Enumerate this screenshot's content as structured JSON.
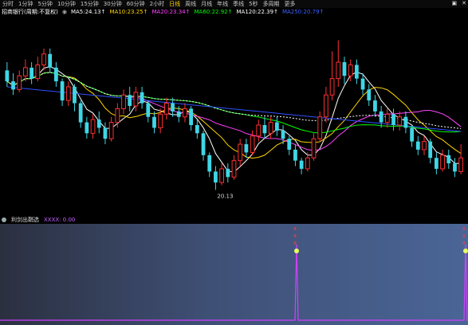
{
  "toolbar": {
    "periods": [
      "分时",
      "1分钟",
      "5分钟",
      "10分钟",
      "15分钟",
      "30分钟",
      "60分钟",
      "2小时",
      "日线",
      "周线",
      "月线",
      "年线",
      "季线",
      "5秒",
      "多周期",
      "更多"
    ],
    "active_period": "日线",
    "right_icons": [
      "grid-icon",
      "close-icon"
    ]
  },
  "ma_row": {
    "title": "招商银行(周期:不复权)",
    "items": [
      {
        "label": "MA5:",
        "value": "24.13",
        "arrow": "↑",
        "color": "#ffffff"
      },
      {
        "label": "MA10:",
        "value": "23.25",
        "arrow": "↑",
        "color": "#ffd400"
      },
      {
        "label": "MA20:",
        "value": "23.34",
        "arrow": "↑",
        "color": "#ff44ff"
      },
      {
        "label": "MA60:",
        "value": "22.92",
        "arrow": "↑",
        "color": "#00ff00"
      },
      {
        "label": "MA120:",
        "value": "22.39",
        "arrow": "↑",
        "color": "#ffffff"
      },
      {
        "label": "MA250:",
        "value": "20.79",
        "arrow": "↑",
        "color": "#4060ff"
      }
    ]
  },
  "chart_data": {
    "type": "candlestick",
    "low_label": "20.13",
    "colors": {
      "up": "#ff3030",
      "down": "#3fd6e6",
      "ma5": "#ffffff",
      "ma10": "#ffd400",
      "ma20": "#ff44ff",
      "ma60": "#00ff00",
      "ma120": "#ffffff",
      "ma250": "#3050ff"
    },
    "candles": [
      [
        24.5,
        24.1,
        24.8,
        23.9
      ],
      [
        24.1,
        23.8,
        24.4,
        23.6
      ],
      [
        23.8,
        24.3,
        24.5,
        23.7
      ],
      [
        24.3,
        24.6,
        24.9,
        24.1
      ],
      [
        24.6,
        24.2,
        24.8,
        24.0
      ],
      [
        24.2,
        24.7,
        25.0,
        24.1
      ],
      [
        24.7,
        25.1,
        25.3,
        24.5
      ],
      [
        25.1,
        24.6,
        25.3,
        24.4
      ],
      [
        24.6,
        24.1,
        24.8,
        23.9
      ],
      [
        24.1,
        23.4,
        24.2,
        23.2
      ],
      [
        23.4,
        23.9,
        24.1,
        23.2
      ],
      [
        23.9,
        23.3,
        24.0,
        23.0
      ],
      [
        23.3,
        22.6,
        23.4,
        22.4
      ],
      [
        22.6,
        22.2,
        22.8,
        22.0
      ],
      [
        22.2,
        22.7,
        22.9,
        22.0
      ],
      [
        22.7,
        22.4,
        23.0,
        22.2
      ],
      [
        22.4,
        22.0,
        22.6,
        21.8
      ],
      [
        22.0,
        22.6,
        22.8,
        21.9
      ],
      [
        22.6,
        23.1,
        23.3,
        22.4
      ],
      [
        23.1,
        23.6,
        23.8,
        22.9
      ],
      [
        23.6,
        23.2,
        23.9,
        23.0
      ],
      [
        23.2,
        23.7,
        23.9,
        23.0
      ],
      [
        23.7,
        23.3,
        23.9,
        23.1
      ],
      [
        23.3,
        22.8,
        23.4,
        22.6
      ],
      [
        22.8,
        22.4,
        23.0,
        22.2
      ],
      [
        22.4,
        22.9,
        23.1,
        22.2
      ],
      [
        22.9,
        23.3,
        23.5,
        22.7
      ],
      [
        23.3,
        23.0,
        23.5,
        22.8
      ],
      [
        23.0,
        22.8,
        23.2,
        22.6
      ],
      [
        22.8,
        23.1,
        23.3,
        22.6
      ],
      [
        23.1,
        22.5,
        23.2,
        22.3
      ],
      [
        22.5,
        22.2,
        22.7,
        22.0
      ],
      [
        22.2,
        21.4,
        22.3,
        21.2
      ],
      [
        21.4,
        20.8,
        21.5,
        20.6
      ],
      [
        20.8,
        20.4,
        21.0,
        20.13
      ],
      [
        20.4,
        20.9,
        21.1,
        20.3
      ],
      [
        20.9,
        20.6,
        21.1,
        20.4
      ],
      [
        20.6,
        21.2,
        21.4,
        20.5
      ],
      [
        21.2,
        21.8,
        22.0,
        21.0
      ],
      [
        21.8,
        21.5,
        22.0,
        21.3
      ],
      [
        21.5,
        22.1,
        22.3,
        21.4
      ],
      [
        22.1,
        22.5,
        22.7,
        21.9
      ],
      [
        22.5,
        22.2,
        22.8,
        22.0
      ],
      [
        22.2,
        22.6,
        22.8,
        22.0
      ],
      [
        22.6,
        22.3,
        22.8,
        22.1
      ],
      [
        22.3,
        22.0,
        22.5,
        21.8
      ],
      [
        22.0,
        21.6,
        22.1,
        21.4
      ],
      [
        21.6,
        21.2,
        21.8,
        21.0
      ],
      [
        21.2,
        20.9,
        21.3,
        20.7
      ],
      [
        20.9,
        21.3,
        21.5,
        20.8
      ],
      [
        21.3,
        22.0,
        22.2,
        21.2
      ],
      [
        22.0,
        22.8,
        23.0,
        21.9
      ],
      [
        22.8,
        23.6,
        23.9,
        22.6
      ],
      [
        23.6,
        24.2,
        25.2,
        23.4
      ],
      [
        24.2,
        24.8,
        25.6,
        23.9
      ],
      [
        24.8,
        24.3,
        25.0,
        24.0
      ],
      [
        24.3,
        24.7,
        24.9,
        24.1
      ],
      [
        24.7,
        24.2,
        24.9,
        24.0
      ],
      [
        24.2,
        23.8,
        24.4,
        23.6
      ],
      [
        23.8,
        23.4,
        24.0,
        23.2
      ],
      [
        23.4,
        23.0,
        23.6,
        22.8
      ],
      [
        23.0,
        22.6,
        23.2,
        22.4
      ],
      [
        22.6,
        22.9,
        23.1,
        22.4
      ],
      [
        22.9,
        22.5,
        23.1,
        22.3
      ],
      [
        22.5,
        22.8,
        23.0,
        22.3
      ],
      [
        22.8,
        22.4,
        23.0,
        22.2
      ],
      [
        22.4,
        21.9,
        22.5,
        21.7
      ],
      [
        21.9,
        21.6,
        22.1,
        21.4
      ],
      [
        21.6,
        21.9,
        22.1,
        21.4
      ],
      [
        21.9,
        21.3,
        22.0,
        21.1
      ],
      [
        21.3,
        20.9,
        21.5,
        20.7
      ],
      [
        20.9,
        21.4,
        21.6,
        20.8
      ],
      [
        21.4,
        21.1,
        21.6,
        20.9
      ],
      [
        21.1,
        20.8,
        21.3,
        20.6
      ],
      [
        20.8,
        21.3,
        21.8,
        20.7
      ]
    ]
  },
  "status_bar": {
    "label": "利剑出鞘选",
    "value": "XXXX: 0.00",
    "value_color": "#c060ff"
  },
  "indicator_data": {
    "type": "line",
    "spike_label": "XXX",
    "spike_count": 2
  }
}
